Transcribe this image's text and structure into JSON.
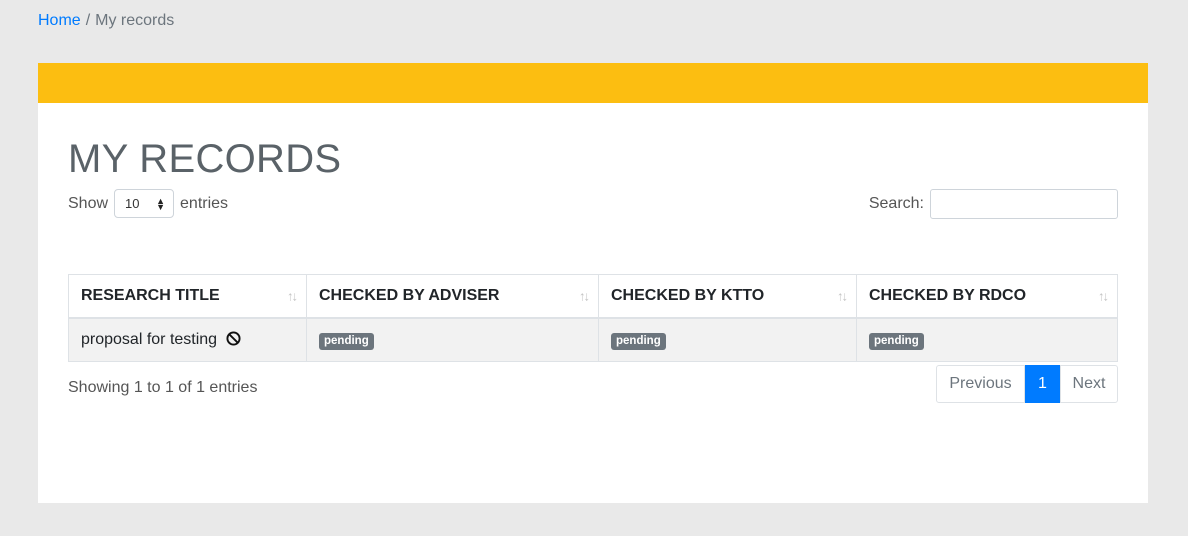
{
  "breadcrumb": {
    "home": "Home",
    "separator": "/",
    "current": "My records"
  },
  "page": {
    "title": "MY RECORDS"
  },
  "length": {
    "show_label": "Show",
    "value": "10",
    "entries_label": "entries"
  },
  "search": {
    "label": "Search:",
    "value": "",
    "placeholder": ""
  },
  "table": {
    "columns": [
      "RESEARCH TITLE",
      "CHECKED BY ADVISER",
      "CHECKED BY KTTO",
      "CHECKED BY RDCO"
    ],
    "rows": [
      {
        "title": "proposal for testing",
        "adviser": "pending",
        "ktto": "pending",
        "rdco": "pending"
      }
    ]
  },
  "info": "Showing 1 to 1 of 1 entries",
  "pagination": {
    "previous": "Previous",
    "current": "1",
    "next": "Next"
  },
  "colors": {
    "header_bar": "#fcbe11",
    "link": "#007bff",
    "badge": "#6c757d",
    "active_page": "#007bff"
  },
  "icons": {
    "title_status": "ban-icon",
    "sort": "sort-icon",
    "select": "select-arrows-icon"
  }
}
